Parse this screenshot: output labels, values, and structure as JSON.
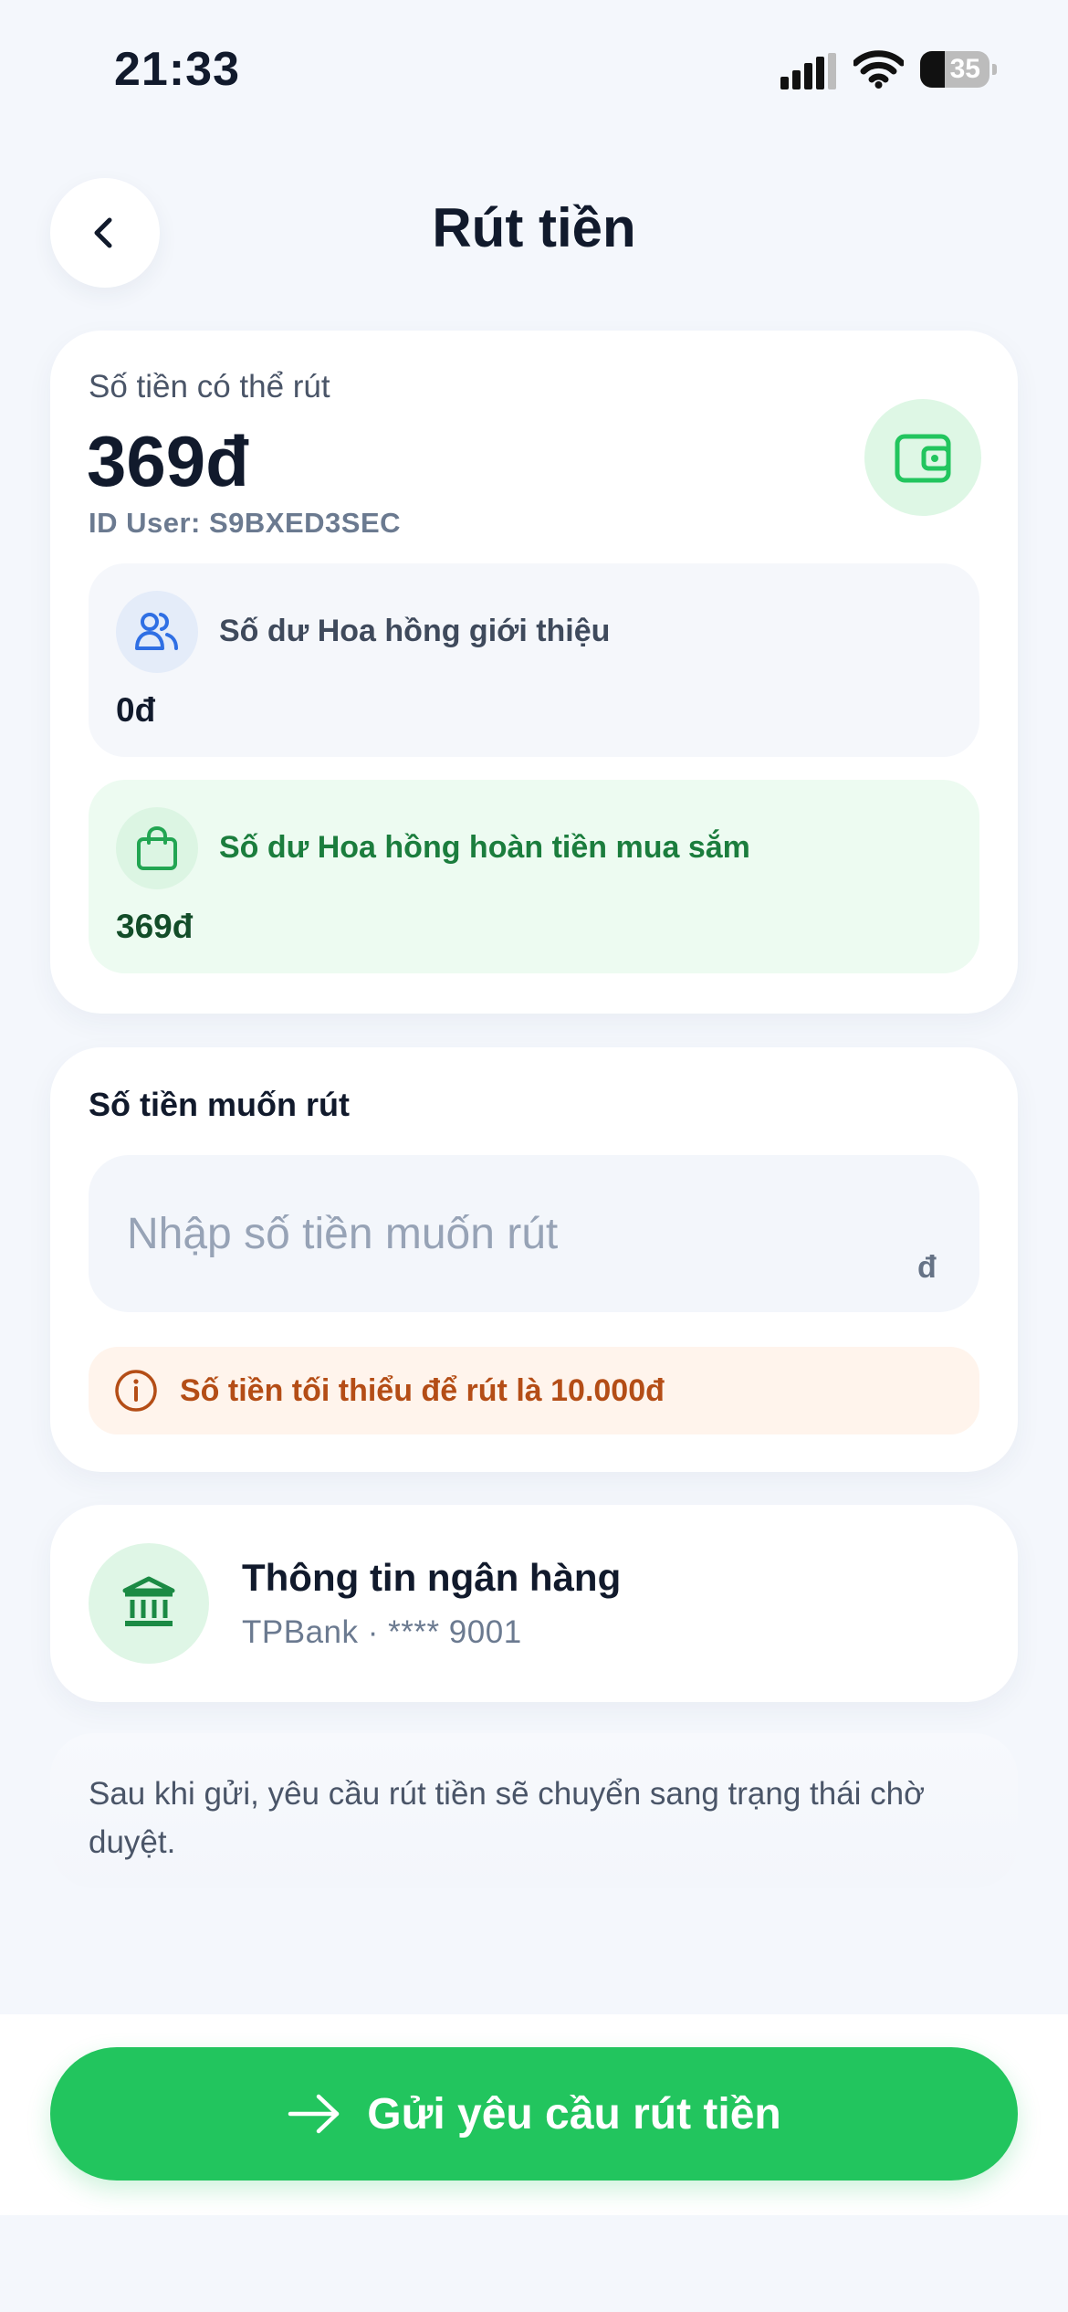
{
  "status_bar": {
    "time": "21:33",
    "battery": "35",
    "battery_level": 0.35
  },
  "header": {
    "title": "Rút tiền"
  },
  "balance_card": {
    "label": "Số tiền có thể rút",
    "amount": "369đ",
    "user_id": "ID User: S9BXED3SEC",
    "referral": {
      "title": "Số dư Hoa hồng giới thiệu",
      "value": "0đ"
    },
    "cashback": {
      "title": "Số dư Hoa hồng hoàn tiền mua sắm",
      "value": "369đ"
    }
  },
  "withdraw_form": {
    "label": "Số tiền muốn rút",
    "placeholder": "Nhập số tiền muốn rút",
    "value": "",
    "currency": "đ",
    "min_notice": "Số tiền tối thiểu để rút là 10.000đ"
  },
  "bank_card": {
    "title": "Thông tin ngân hàng",
    "detail": "TPBank · **** 9001"
  },
  "note": "Sau khi gửi, yêu cầu rút tiền sẽ chuyển sang trạng thái chờ duyệt.",
  "submit": {
    "label": "Gửi yêu cầu rút tiền"
  },
  "colors": {
    "accent": "#22c55e",
    "title_text": "#111a2c",
    "warning_text": "#b44d16",
    "warning_bg": "#fff4ec",
    "cashback_bg": "#edfbf1",
    "referral_icon": "#2f6fe4"
  },
  "icons": {
    "back": "chevron-left-icon",
    "wallet": "wallet-icon",
    "referral": "users-icon",
    "cashback": "shopping-bag-icon",
    "min_notice": "info-icon",
    "bank": "bank-icon",
    "submit": "arrow-right-icon"
  }
}
